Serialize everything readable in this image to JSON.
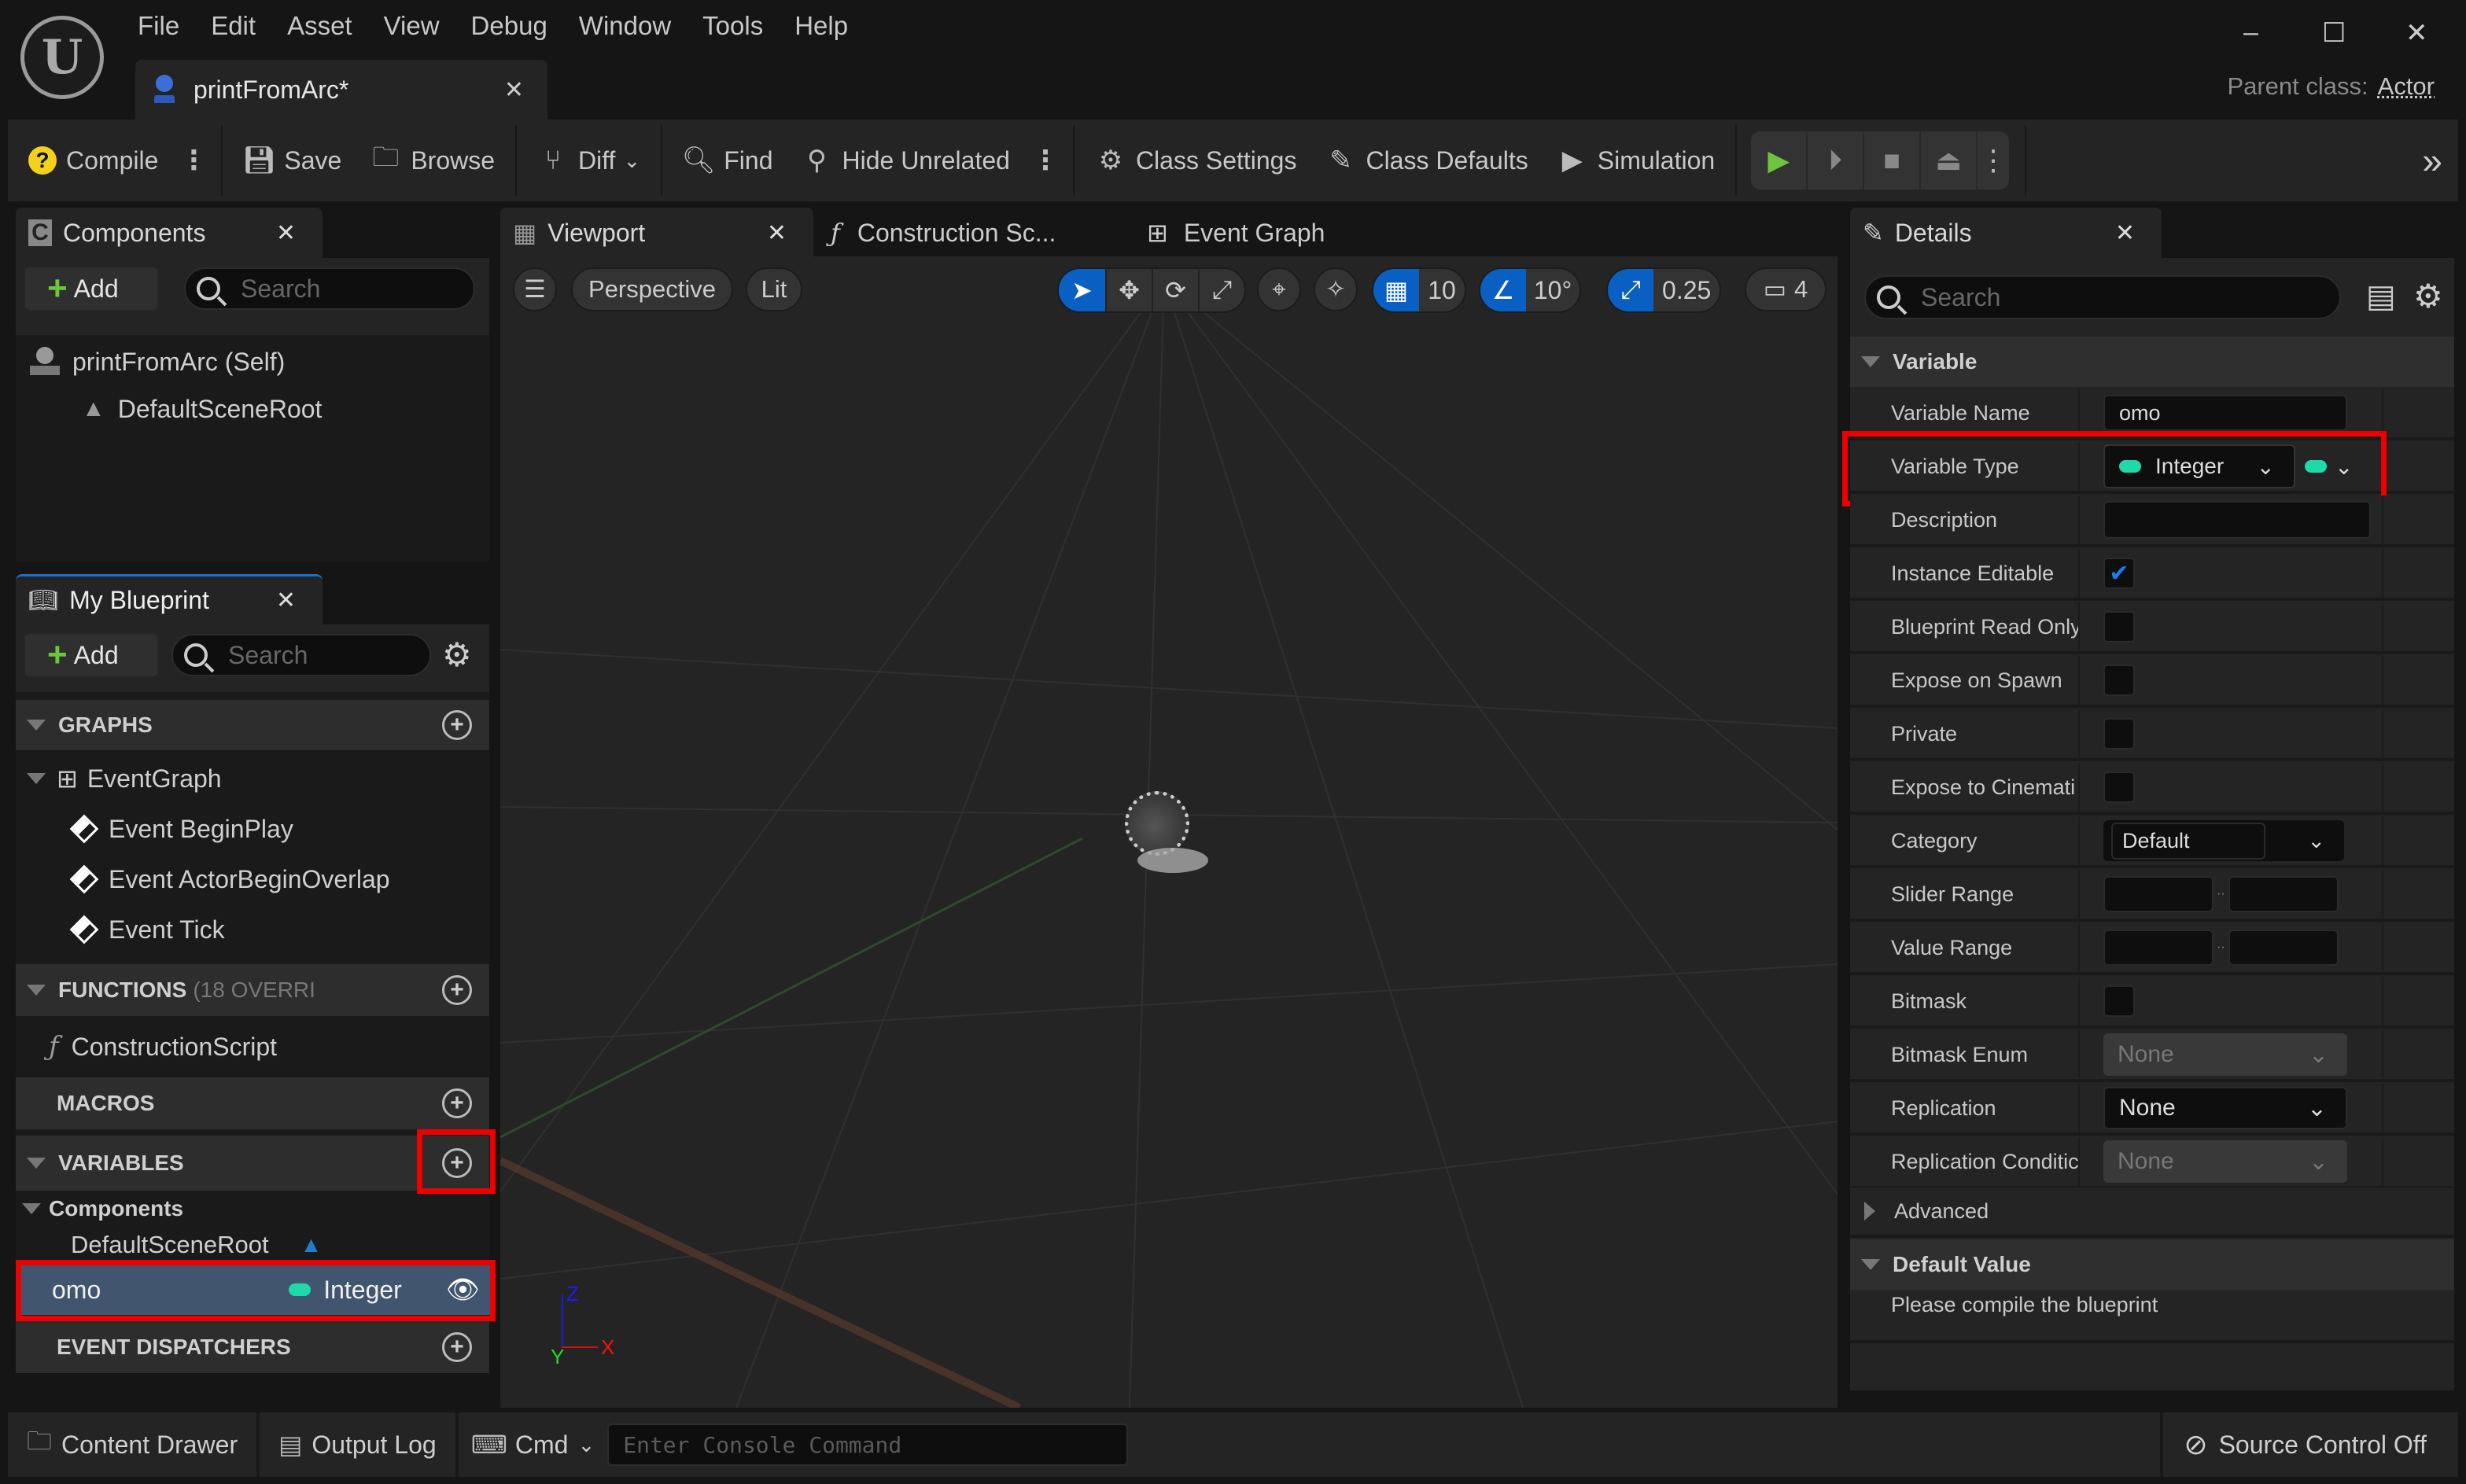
{
  "window": {
    "menu": [
      "File",
      "Edit",
      "Asset",
      "View",
      "Debug",
      "Window",
      "Tools",
      "Help"
    ],
    "document_tab": "printFromArc*",
    "parent_class_label": "Parent class:",
    "parent_class_value": "Actor",
    "controls": {
      "minimize": "–",
      "maximize": "☐",
      "close": "✕"
    }
  },
  "toolbar": {
    "compile": "Compile",
    "save": "Save",
    "browse": "Browse",
    "diff": "Diff",
    "find": "Find",
    "hide_unrelated": "Hide Unrelated",
    "class_settings": "Class Settings",
    "class_defaults": "Class Defaults",
    "simulation": "Simulation"
  },
  "components_panel": {
    "title": "Components",
    "add_label": "Add",
    "search_placeholder": "Search",
    "items": [
      {
        "label": "printFromArc (Self)",
        "icon": "actor-icon"
      },
      {
        "label": "DefaultSceneRoot",
        "icon": "scene-component-icon"
      }
    ]
  },
  "my_blueprint": {
    "title": "My Blueprint",
    "add_label": "Add",
    "search_placeholder": "Search",
    "graphs": {
      "header": "GRAPHS",
      "event_graph": "EventGraph",
      "events": [
        "Event BeginPlay",
        "Event ActorBeginOverlap",
        "Event Tick"
      ]
    },
    "functions": {
      "header": "FUNCTIONS",
      "suffix": "(18 OVERRI",
      "items": [
        "ConstructionScript"
      ]
    },
    "macros": {
      "header": "MACROS"
    },
    "variables": {
      "header": "VARIABLES",
      "group": "Components",
      "component_var": "DefaultSceneRoot",
      "selected_var": {
        "name": "omo",
        "type": "Integer",
        "type_color": "#1fd9a9"
      }
    },
    "event_dispatchers": {
      "header": "EVENT DISPATCHERS"
    }
  },
  "editor_tabs": [
    {
      "label": "Viewport",
      "active": true
    },
    {
      "label": "Construction Sc...",
      "active": false
    },
    {
      "label": "Event Graph",
      "active": false
    }
  ],
  "viewport": {
    "view_mode": "Perspective",
    "lighting": "Lit",
    "grid_snap": "10",
    "rotation_snap": "10°",
    "scale_snap": "0.25",
    "camera_speed": "4",
    "axis_labels": {
      "x": "X",
      "y": "Y",
      "z": "Z"
    }
  },
  "details": {
    "title": "Details",
    "search_placeholder": "Search",
    "variable_section": "Variable",
    "rows": {
      "variable_name": {
        "label": "Variable Name",
        "value": "omo"
      },
      "variable_type": {
        "label": "Variable Type",
        "value": "Integer"
      },
      "description": {
        "label": "Description",
        "value": ""
      },
      "instance_editable": {
        "label": "Instance Editable",
        "checked": true
      },
      "blueprint_read_only": {
        "label": "Blueprint Read Only",
        "checked": false
      },
      "expose_on_spawn": {
        "label": "Expose on Spawn",
        "checked": false
      },
      "private": {
        "label": "Private",
        "checked": false
      },
      "expose_to_cinematics": {
        "label": "Expose to Cinemati",
        "checked": false
      },
      "category": {
        "label": "Category",
        "value": "Default"
      },
      "slider_range": {
        "label": "Slider Range",
        "min": "",
        "max": ""
      },
      "value_range": {
        "label": "Value Range",
        "min": "",
        "max": ""
      },
      "bitmask": {
        "label": "Bitmask",
        "checked": false
      },
      "bitmask_enum": {
        "label": "Bitmask Enum",
        "value": "None"
      },
      "replication": {
        "label": "Replication",
        "value": "None"
      },
      "replication_condition": {
        "label": "Replication Conditic",
        "value": "None"
      }
    },
    "advanced": "Advanced",
    "default_value_section": "Default Value",
    "default_value_message": "Please compile the blueprint"
  },
  "bottom_bar": {
    "content_drawer": "Content Drawer",
    "output_log": "Output Log",
    "cmd": "Cmd",
    "console_placeholder": "Enter Console Command",
    "source_control": "Source Control Off"
  },
  "colors": {
    "accent_blue": "#0a5fc2",
    "highlight_red": "#ee0000",
    "integer_pin": "#1fd9a9",
    "play_green": "#6ec43c"
  }
}
